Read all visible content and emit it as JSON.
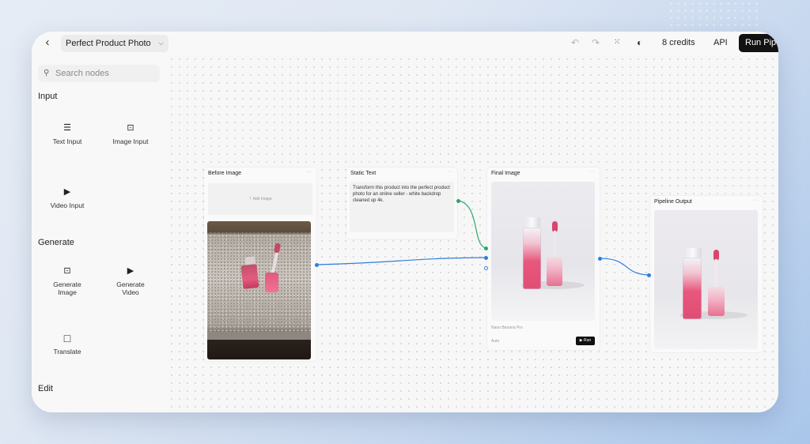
{
  "app": {
    "project_name": "Perfect Product Photo",
    "credits_label": "8 credits",
    "api_label": "API",
    "run_label": "Run Pipeline"
  },
  "icons": {
    "back": "chevron-left-icon",
    "dropdown": "chevron-down-icon",
    "undo": "undo-icon",
    "redo": "redo-icon",
    "grid": "grid-icon",
    "theme": "contrast-icon",
    "search": "search-icon"
  },
  "sidebar": {
    "search_placeholder": "Search nodes",
    "sections": [
      {
        "title": "Input",
        "items": [
          "Text Input",
          "Image Input",
          "Video Input"
        ]
      },
      {
        "title": "Generate",
        "items": [
          "Generate Image",
          "Generate Video",
          "Translate"
        ]
      },
      {
        "title": "Edit",
        "items": []
      }
    ]
  },
  "nodes": {
    "before_image": {
      "title": "Before Image",
      "add_image_label": "Add Image",
      "menu": "···"
    },
    "static_text": {
      "title": "Static Text",
      "text": "Transform this product into the perfect product photo for an online seller - white backdrop cleaned up 4k.",
      "menu": "···"
    },
    "final_image": {
      "title": "Final Image",
      "model": "Nano Banana Pro",
      "mode": "Auto",
      "run_label": "Run",
      "menu": "···"
    },
    "pipeline_output": {
      "title": "Pipeline Output",
      "menu": "···"
    }
  },
  "colors": {
    "accent_wire": "#2f7de1",
    "text_wire": "#2da66a",
    "run_button_bg": "#121212"
  }
}
